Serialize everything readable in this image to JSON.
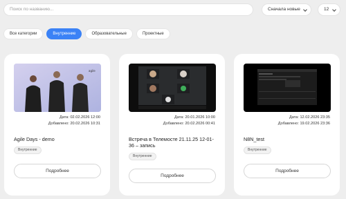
{
  "toolbar": {
    "search_placeholder": "Поиск по названию...",
    "sort_label": "Сначала новые",
    "per_page": "12"
  },
  "tabs": [
    {
      "label": "Все категории"
    },
    {
      "label": "Внутренние"
    },
    {
      "label": "Образовательные"
    },
    {
      "label": "Проектные"
    }
  ],
  "cards": [
    {
      "date_line": "Дата: 02.02.2026 12:00",
      "added_line": "Добавлено: 20.02.2026 10:31",
      "title": "Agile Days - demo",
      "category": "Внутренние",
      "button": "Подробнее"
    },
    {
      "date_line": "Дата: 20.01.2026 10:00",
      "added_line": "Добавлено: 20.02.2026 00:41",
      "title": "Встреча в Телемосте 21.11.25 12-01-36 – запись",
      "category": "Внутренние",
      "button": "Подробнее"
    },
    {
      "date_line": "Дата: 12.02.2026 23:35",
      "added_line": "Добавлено: 19.02.2026 23:36",
      "title": "N8N_test",
      "category": "Внутренние",
      "button": "Подробнее"
    }
  ],
  "colors": {
    "accent": "#3b82f6",
    "background": "#eeeeee"
  }
}
